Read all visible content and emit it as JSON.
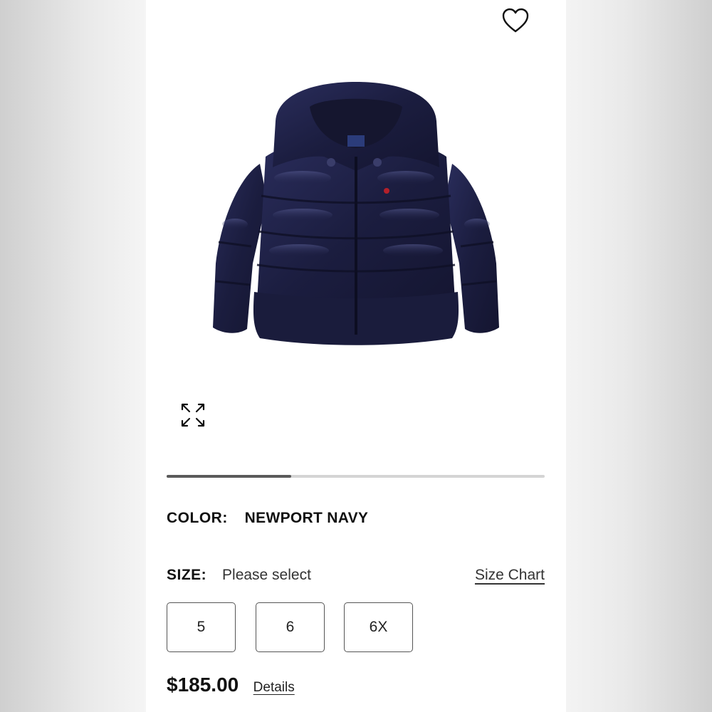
{
  "product": {
    "image_alt": "navy puffer jacket with hood",
    "image_progress": 0.33
  },
  "color": {
    "label": "COLOR:",
    "value": "NEWPORT NAVY"
  },
  "size": {
    "label": "SIZE:",
    "value": "Please select",
    "chart_link": "Size Chart",
    "options": [
      "5",
      "6",
      "6X"
    ]
  },
  "pricing": {
    "price": "$185.00",
    "details_link": "Details"
  },
  "icons": {
    "wishlist": "heart-icon",
    "expand": "expand-icon"
  },
  "colors": {
    "jacket": "#1b1d3f",
    "progress_fill": "#5a5a5a",
    "progress_track": "#d4d4d4",
    "logo_red": "#b3202a"
  }
}
